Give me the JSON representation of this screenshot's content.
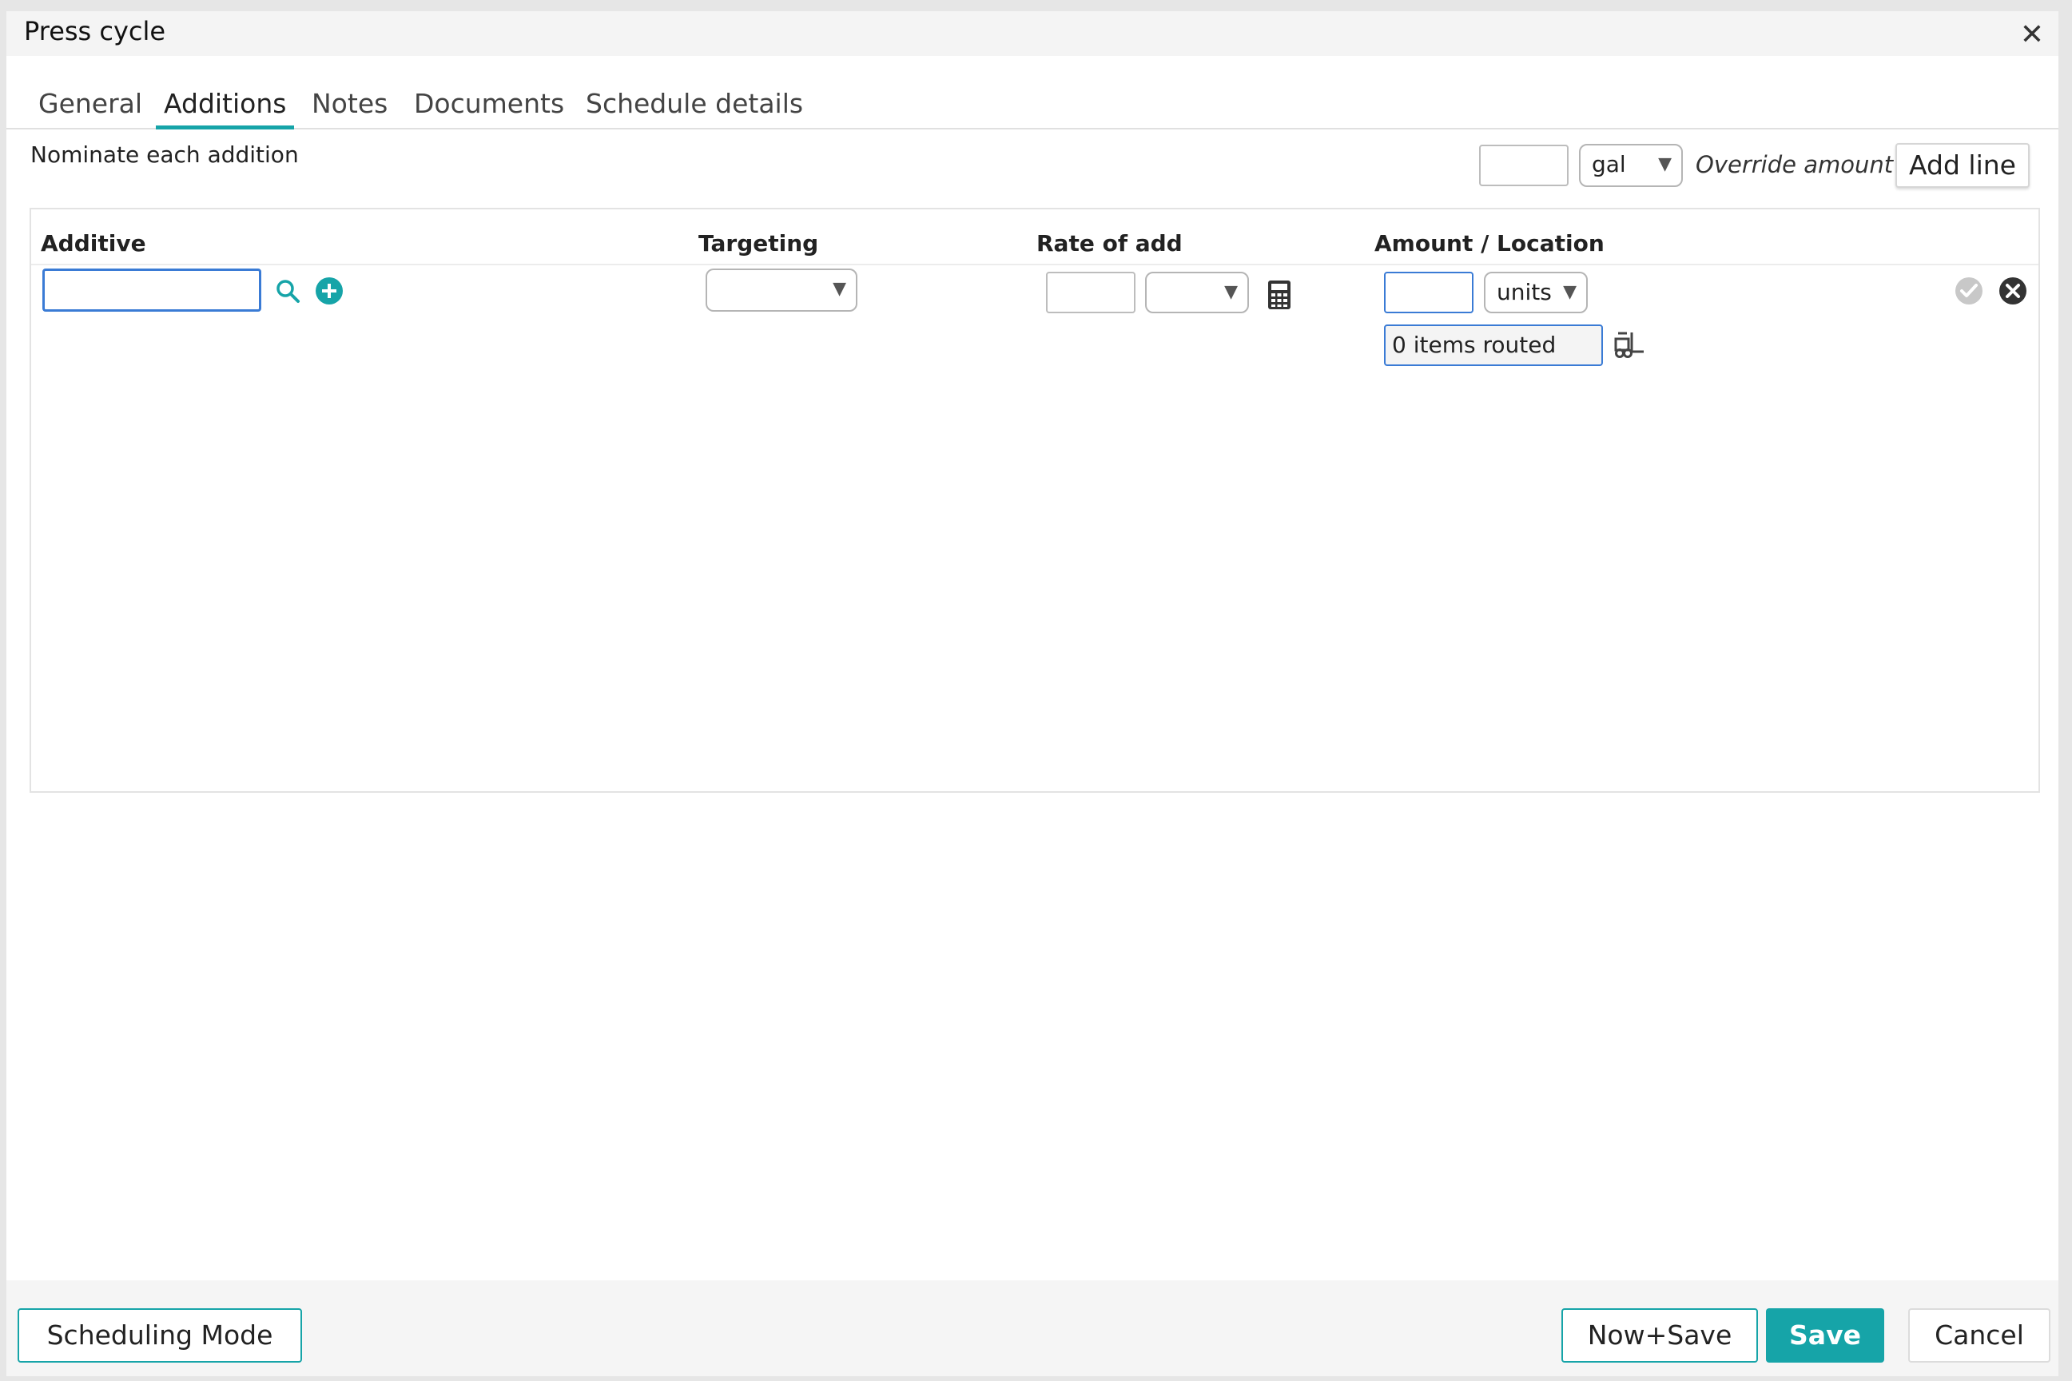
{
  "dialog": {
    "title": "Press cycle"
  },
  "tabs": [
    {
      "label": "General"
    },
    {
      "label": "Additions"
    },
    {
      "label": "Notes"
    },
    {
      "label": "Documents"
    },
    {
      "label": "Schedule details"
    }
  ],
  "nominate_label": "Nominate each addition",
  "override": {
    "amount_value": "",
    "unit_selected": "gal",
    "label": "Override amount",
    "add_line_label": "Add line"
  },
  "columns": {
    "additive": "Additive",
    "targeting": "Targeting",
    "rate": "Rate of add",
    "amount": "Amount / Location"
  },
  "row": {
    "additive_value": "",
    "targeting_selected": "",
    "rate_value": "",
    "rate_unit_selected": "",
    "amount_value": "",
    "amount_unit_selected": "units",
    "routed_value": "0 items routed"
  },
  "footer": {
    "scheduling_mode": "Scheduling Mode",
    "now_save": "Now+Save",
    "save": "Save",
    "cancel": "Cancel"
  },
  "colors": {
    "accent": "#16a4a8",
    "focus_border": "#3a7bd5"
  },
  "icons": {
    "close": "close-icon",
    "search": "search-icon",
    "add": "plus-circle-icon",
    "calculator": "calculator-icon",
    "forklift": "forklift-icon",
    "confirm": "check-circle-icon",
    "remove": "x-circle-icon"
  }
}
